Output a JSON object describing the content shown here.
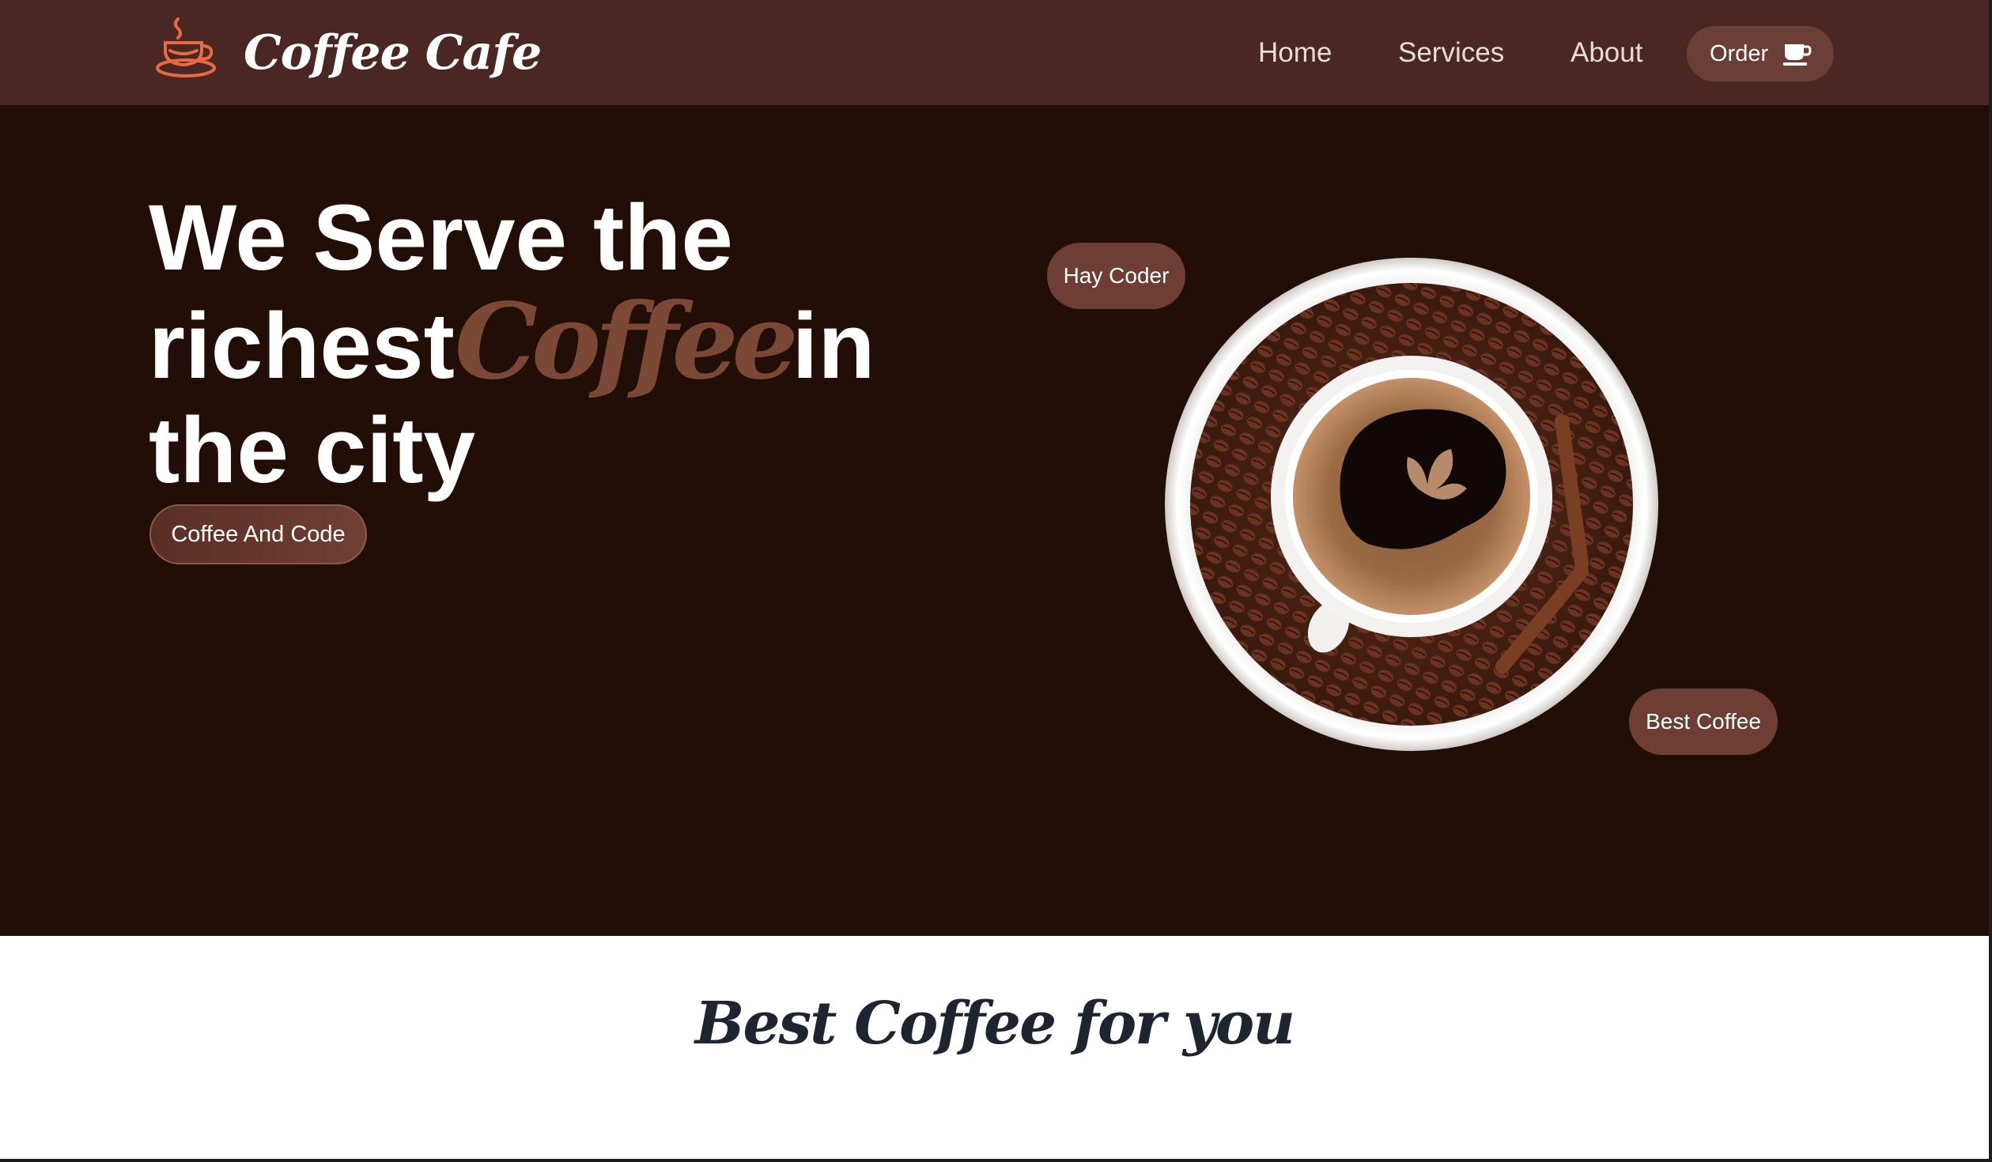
{
  "brand": {
    "name": "Coffee Cafe",
    "icon": "coffee-cup-logo-icon",
    "icon_color": "#e86a44"
  },
  "nav": {
    "links": [
      "Home",
      "Services",
      "About"
    ],
    "order_label": "Order",
    "order_icon": "coffee-cup-icon"
  },
  "hero": {
    "headline_line1": "We Serve the",
    "headline_line2_pre": "richest",
    "headline_highlight": "Coffee",
    "headline_line2_post": "in",
    "headline_line3": "the city",
    "cta_label": "Coffee And Code",
    "image": "coffee-cup-on-beans-image",
    "bubble_top": "Hay Coder",
    "bubble_bottom": "Best Coffee"
  },
  "section": {
    "title": "Best Coffee for you"
  },
  "colors": {
    "nav_bg": "#4b2723",
    "hero_bg": "#220e07",
    "accent": "#6e3d33",
    "highlight": "#7b4836",
    "title_dark": "#1e2430"
  }
}
